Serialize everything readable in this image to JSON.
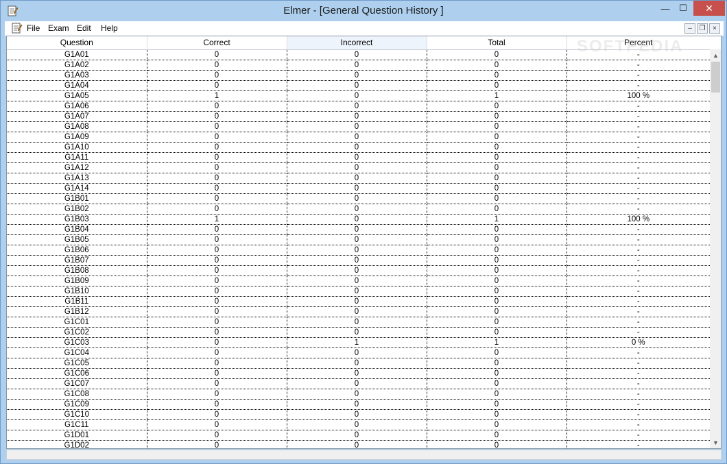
{
  "window": {
    "title": "Elmer - [General Question History ]",
    "minimize_glyph": "—",
    "maximize_glyph": "☐",
    "close_glyph": "✕"
  },
  "menu": [
    "File",
    "Exam",
    "Edit",
    "Help"
  ],
  "mdi": {
    "minimize": "–",
    "restore": "❐",
    "close": "×"
  },
  "watermark": "SOFTPEDIA",
  "colors": {
    "titlebar": "#aed0ee",
    "close": "#c7504c",
    "header_highlight": "#eef4fb"
  },
  "table": {
    "columns": [
      "Question",
      "Correct",
      "Incorrect",
      "Total",
      "Percent"
    ],
    "rows": [
      [
        "G1A01",
        "0",
        "0",
        "0",
        "-"
      ],
      [
        "G1A02",
        "0",
        "0",
        "0",
        "-"
      ],
      [
        "G1A03",
        "0",
        "0",
        "0",
        "-"
      ],
      [
        "G1A04",
        "0",
        "0",
        "0",
        "-"
      ],
      [
        "G1A05",
        "1",
        "0",
        "1",
        "100 %"
      ],
      [
        "G1A06",
        "0",
        "0",
        "0",
        "-"
      ],
      [
        "G1A07",
        "0",
        "0",
        "0",
        "-"
      ],
      [
        "G1A08",
        "0",
        "0",
        "0",
        "-"
      ],
      [
        "G1A09",
        "0",
        "0",
        "0",
        "-"
      ],
      [
        "G1A10",
        "0",
        "0",
        "0",
        "-"
      ],
      [
        "G1A11",
        "0",
        "0",
        "0",
        "-"
      ],
      [
        "G1A12",
        "0",
        "0",
        "0",
        "-"
      ],
      [
        "G1A13",
        "0",
        "0",
        "0",
        "-"
      ],
      [
        "G1A14",
        "0",
        "0",
        "0",
        "-"
      ],
      [
        "G1B01",
        "0",
        "0",
        "0",
        "-"
      ],
      [
        "G1B02",
        "0",
        "0",
        "0",
        "-"
      ],
      [
        "G1B03",
        "1",
        "0",
        "1",
        "100 %"
      ],
      [
        "G1B04",
        "0",
        "0",
        "0",
        "-"
      ],
      [
        "G1B05",
        "0",
        "0",
        "0",
        "-"
      ],
      [
        "G1B06",
        "0",
        "0",
        "0",
        "-"
      ],
      [
        "G1B07",
        "0",
        "0",
        "0",
        "-"
      ],
      [
        "G1B08",
        "0",
        "0",
        "0",
        "-"
      ],
      [
        "G1B09",
        "0",
        "0",
        "0",
        "-"
      ],
      [
        "G1B10",
        "0",
        "0",
        "0",
        "-"
      ],
      [
        "G1B11",
        "0",
        "0",
        "0",
        "-"
      ],
      [
        "G1B12",
        "0",
        "0",
        "0",
        "-"
      ],
      [
        "G1C01",
        "0",
        "0",
        "0",
        "-"
      ],
      [
        "G1C02",
        "0",
        "0",
        "0",
        "-"
      ],
      [
        "G1C03",
        "0",
        "1",
        "1",
        "0 %"
      ],
      [
        "G1C04",
        "0",
        "0",
        "0",
        "-"
      ],
      [
        "G1C05",
        "0",
        "0",
        "0",
        "-"
      ],
      [
        "G1C06",
        "0",
        "0",
        "0",
        "-"
      ],
      [
        "G1C07",
        "0",
        "0",
        "0",
        "-"
      ],
      [
        "G1C08",
        "0",
        "0",
        "0",
        "-"
      ],
      [
        "G1C09",
        "0",
        "0",
        "0",
        "-"
      ],
      [
        "G1C10",
        "0",
        "0",
        "0",
        "-"
      ],
      [
        "G1C11",
        "0",
        "0",
        "0",
        "-"
      ],
      [
        "G1D01",
        "0",
        "0",
        "0",
        "-"
      ],
      [
        "G1D02",
        "0",
        "0",
        "0",
        "-"
      ]
    ]
  },
  "scrollbar": {
    "up_glyph": "▲",
    "down_glyph": "▼"
  }
}
